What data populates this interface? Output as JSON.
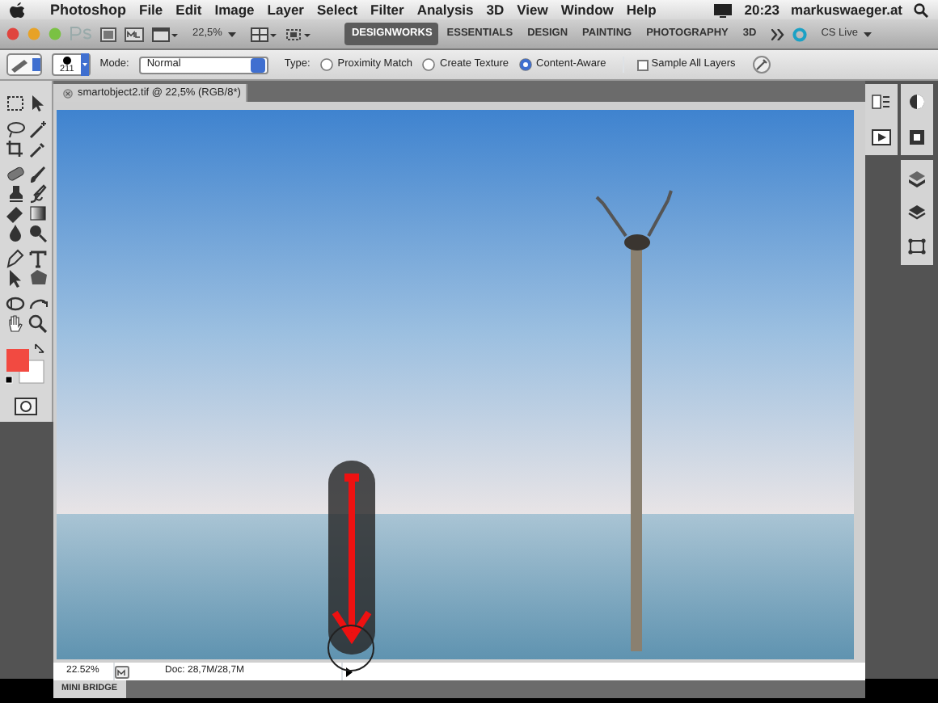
{
  "menu_bar": {
    "items": [
      "Photoshop",
      "File",
      "Edit",
      "Image",
      "Layer",
      "Select",
      "Filter",
      "Analysis",
      "3D",
      "View",
      "Window",
      "Help"
    ],
    "clock": "20:23",
    "user": "markuswaeger.at"
  },
  "app_bar": {
    "zoom": "22,5%",
    "workspaces": [
      {
        "label": "DESIGNWORKS",
        "selected": true
      },
      {
        "label": "ESSENTIALS",
        "selected": false
      },
      {
        "label": "DESIGN",
        "selected": false
      },
      {
        "label": "PAINTING",
        "selected": false
      },
      {
        "label": "PHOTOGRAPHY",
        "selected": false
      },
      {
        "label": "3D",
        "selected": false
      }
    ],
    "cs_live": "CS Live"
  },
  "options_bar": {
    "brush_size": "211",
    "mode_label": "Mode:",
    "mode_value": "Normal",
    "type_label": "Type:",
    "type_options": [
      {
        "label": "Proximity Match",
        "selected": false
      },
      {
        "label": "Create Texture",
        "selected": false
      },
      {
        "label": "Content-Aware",
        "selected": true
      }
    ],
    "sample_all_layers": {
      "label": "Sample All Layers",
      "checked": false
    }
  },
  "document": {
    "tab_title": "smartobject2.tif @ 22,5% (RGB/8*)",
    "status_zoom": "22.52%",
    "doc_size": "Doc: 28,7M/28,7M"
  },
  "bottom_panel": {
    "tab": "MINI BRIDGE"
  }
}
